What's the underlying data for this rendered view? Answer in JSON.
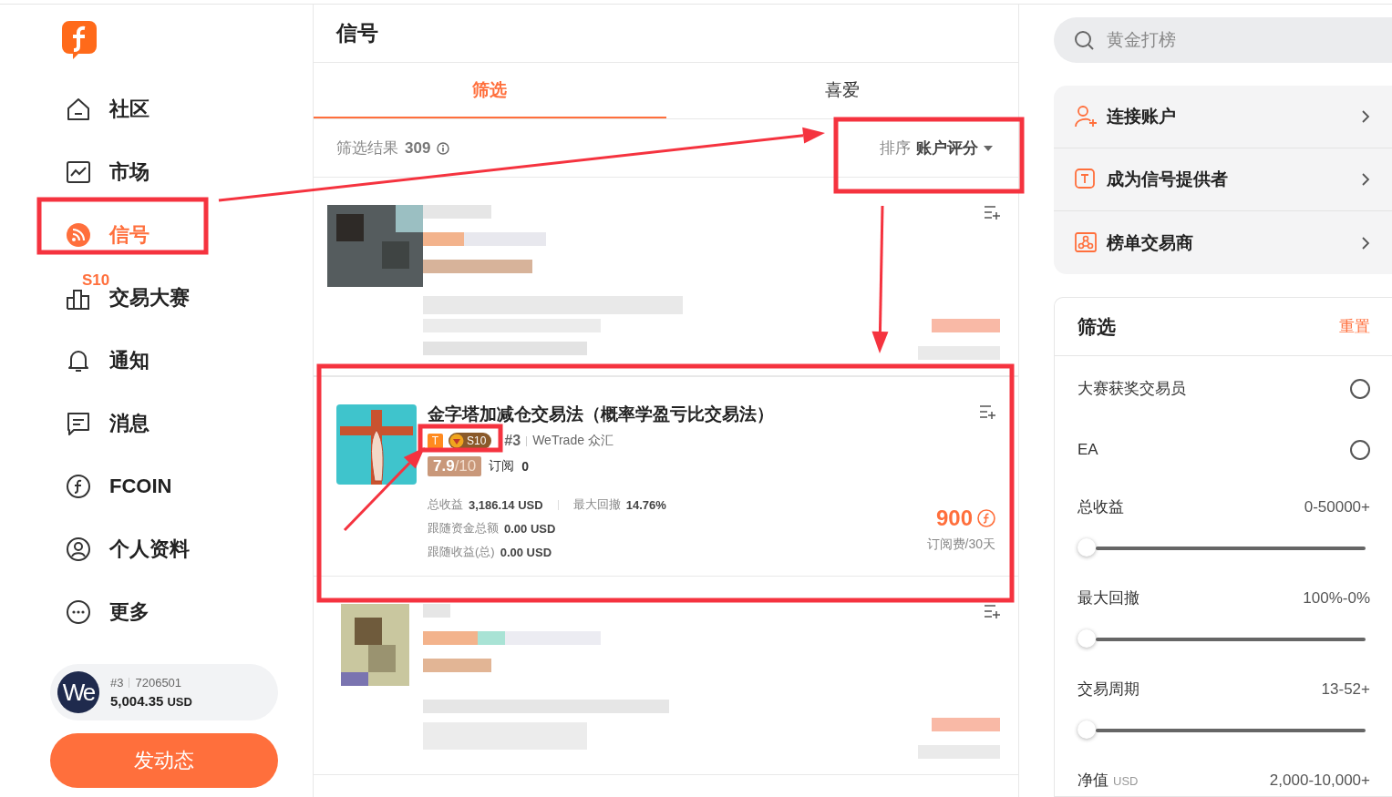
{
  "sidebar": {
    "nav": [
      {
        "label": "社区",
        "selected": false
      },
      {
        "label": "市场",
        "selected": false
      },
      {
        "label": "信号",
        "selected": true
      },
      {
        "label": "交易大赛",
        "selected": false,
        "badge": "S10"
      },
      {
        "label": "通知",
        "selected": false
      },
      {
        "label": "消息",
        "selected": false
      },
      {
        "label": "FCOIN",
        "selected": false
      },
      {
        "label": "个人资料",
        "selected": false
      },
      {
        "label": "更多",
        "selected": false
      }
    ],
    "account": {
      "avatar": "We",
      "rank": "#3",
      "number": "7206501",
      "balance": "5,004.35",
      "currency": "USD"
    },
    "post_button": "发动态"
  },
  "main": {
    "title": "信号",
    "tabs": [
      {
        "label": "筛选",
        "selected": true
      },
      {
        "label": "喜爱",
        "selected": false
      }
    ],
    "results": {
      "label": "筛选结果",
      "count": "309"
    },
    "sort": {
      "label": "排序",
      "value": "账户评分"
    },
    "signals": [
      {
        "kind": "blurred"
      },
      {
        "kind": "full",
        "title": "金字塔加减仓交易法（概率学盈亏比交易法）",
        "tag": "T",
        "season": "S10",
        "rank": "#3",
        "broker": "WeTrade 众汇",
        "score": "7.9",
        "score_max": "/10",
        "subs_label": "订阅",
        "subs": "0",
        "stats": [
          {
            "label": "总收益",
            "value": "3,186.14 USD"
          },
          {
            "label": "最大回撤",
            "value": "14.76%"
          }
        ],
        "follow": [
          {
            "label": "跟随资金总额",
            "value": "0.00 USD"
          },
          {
            "label": "跟随收益(总)",
            "value": "0.00 USD"
          }
        ],
        "price": "900",
        "price_note": "订阅费/30天"
      },
      {
        "kind": "blurred"
      }
    ]
  },
  "right": {
    "search": {
      "placeholder": "黄金打榜"
    },
    "links": [
      {
        "label": "连接账户"
      },
      {
        "label": "成为信号提供者"
      },
      {
        "label": "榜单交易商"
      }
    ],
    "filter": {
      "title": "筛选",
      "reset": "重置",
      "items": [
        {
          "kind": "toggle",
          "label": "大赛获奖交易员",
          "checked": false
        },
        {
          "kind": "toggle",
          "label": "EA",
          "checked": false
        },
        {
          "kind": "range",
          "label": "总收益",
          "range": "0-50000+",
          "level": 0
        },
        {
          "kind": "range",
          "label": "最大回撤",
          "range": "100%-0%",
          "level": 0
        },
        {
          "kind": "range",
          "label": "交易周期",
          "range": "13-52+",
          "level": 0
        },
        {
          "kind": "range",
          "label": "净值",
          "unit": "USD",
          "range": "2,000-10,000+"
        }
      ]
    }
  }
}
